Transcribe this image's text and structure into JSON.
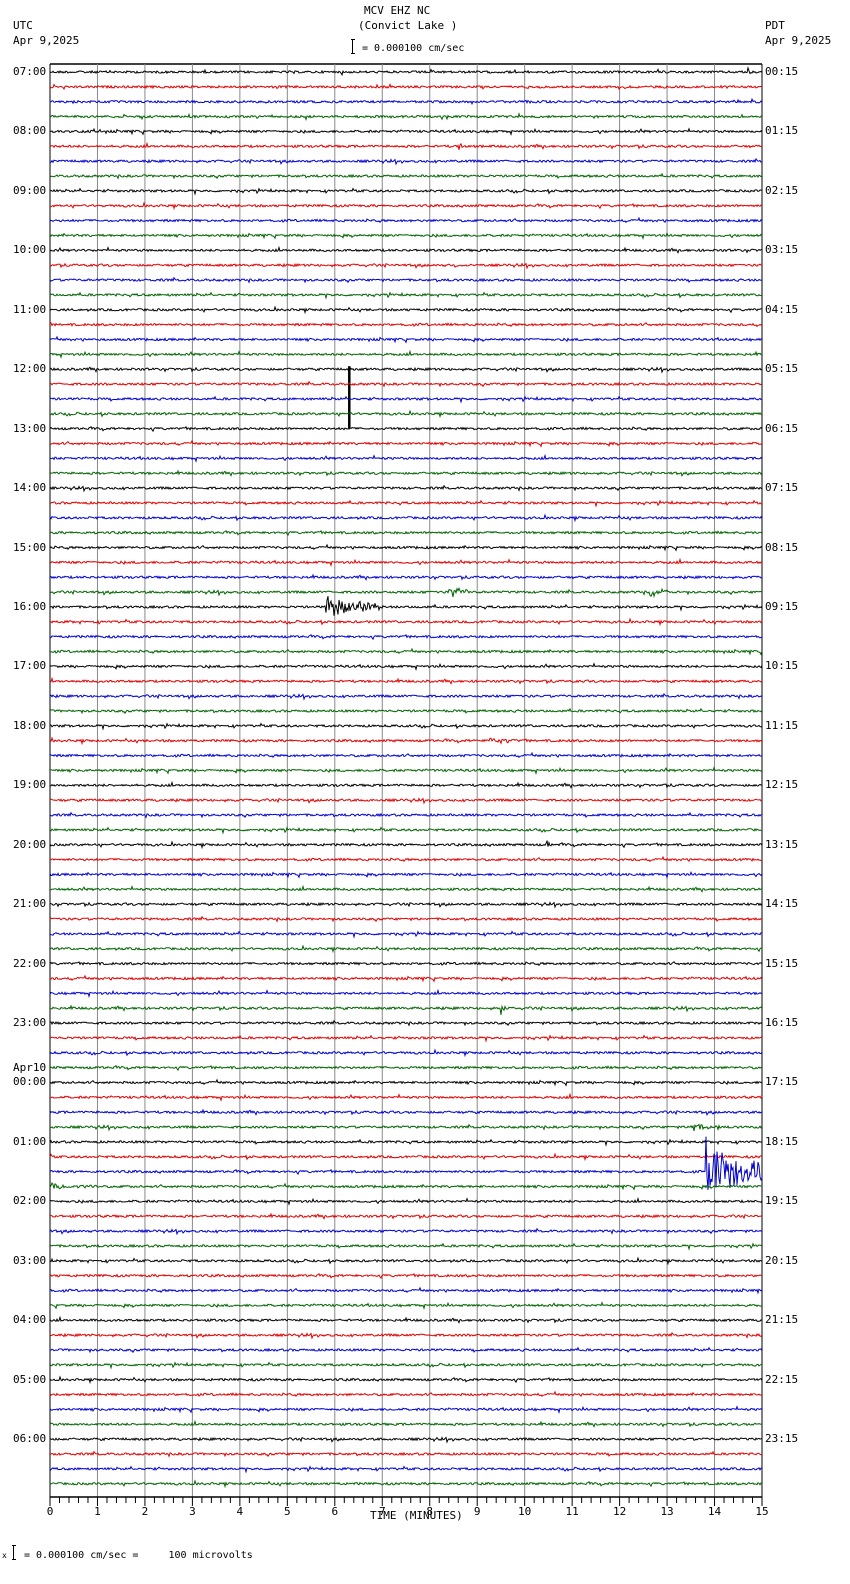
{
  "header": {
    "station": "MCV EHZ NC",
    "location": "(Convict Lake )",
    "scale_text": "= 0.000100 cm/sec",
    "left_tz": "UTC",
    "left_date": "Apr 9,2025",
    "right_tz": "PDT",
    "right_date": "Apr 9,2025"
  },
  "footer": {
    "scale_text": "= 0.000100 cm/sec =     100 microvolts",
    "mark": "x"
  },
  "chart_data": {
    "type": "line",
    "title": "MCV EHZ NC (Convict Lake )",
    "xlabel": "TIME (MINUTES)",
    "xlim": [
      0,
      15
    ],
    "x_ticks": [
      "0",
      "1",
      "2",
      "3",
      "4",
      "5",
      "6",
      "7",
      "8",
      "9",
      "10",
      "11",
      "12",
      "13",
      "14",
      "15"
    ],
    "traces_per_hour": 4,
    "trace_count": 96,
    "trace_colors": [
      "#000000",
      "#e00000",
      "#0000d0",
      "#006400"
    ],
    "left_labels": [
      {
        "trace": 0,
        "text": "07:00"
      },
      {
        "trace": 4,
        "text": "08:00"
      },
      {
        "trace": 8,
        "text": "09:00"
      },
      {
        "trace": 12,
        "text": "10:00"
      },
      {
        "trace": 16,
        "text": "11:00"
      },
      {
        "trace": 20,
        "text": "12:00"
      },
      {
        "trace": 24,
        "text": "13:00"
      },
      {
        "trace": 28,
        "text": "14:00"
      },
      {
        "trace": 32,
        "text": "15:00"
      },
      {
        "trace": 36,
        "text": "16:00"
      },
      {
        "trace": 40,
        "text": "17:00"
      },
      {
        "trace": 44,
        "text": "18:00"
      },
      {
        "trace": 48,
        "text": "19:00"
      },
      {
        "trace": 52,
        "text": "20:00"
      },
      {
        "trace": 56,
        "text": "21:00"
      },
      {
        "trace": 60,
        "text": "22:00"
      },
      {
        "trace": 64,
        "text": "23:00"
      },
      {
        "trace": 68,
        "text": "00:00",
        "date": "Apr10"
      },
      {
        "trace": 72,
        "text": "01:00"
      },
      {
        "trace": 76,
        "text": "02:00"
      },
      {
        "trace": 80,
        "text": "03:00"
      },
      {
        "trace": 84,
        "text": "04:00"
      },
      {
        "trace": 88,
        "text": "05:00"
      },
      {
        "trace": 92,
        "text": "06:00"
      }
    ],
    "right_labels": [
      "00:15",
      "01:15",
      "02:15",
      "03:15",
      "04:15",
      "05:15",
      "06:15",
      "07:15",
      "08:15",
      "09:15",
      "10:15",
      "11:15",
      "12:15",
      "13:15",
      "14:15",
      "15:15",
      "16:15",
      "17:15",
      "18:15",
      "19:15",
      "20:15",
      "21:15",
      "22:15",
      "23:15"
    ],
    "events": [
      {
        "trace": 0,
        "minute": 14.7,
        "duration": 0.1,
        "amplitude": 3
      },
      {
        "trace": 5,
        "minute": 8.6,
        "duration": 0.15,
        "amplitude": 4
      },
      {
        "trace": 13,
        "minute": 8.5,
        "duration": 0.15,
        "amplitude": 3
      },
      {
        "trace": 20,
        "minute": 6.3,
        "duration": 0.05,
        "amplitude": 60,
        "spike": true
      },
      {
        "trace": 35,
        "minute": 8.4,
        "duration": 0.4,
        "amplitude": 7
      },
      {
        "trace": 35,
        "minute": 12.6,
        "duration": 0.5,
        "amplitude": 4
      },
      {
        "trace": 36,
        "minute": 5.8,
        "duration": 1.2,
        "amplitude": 10
      },
      {
        "trace": 45,
        "minute": 9.2,
        "duration": 0.6,
        "amplitude": 3
      },
      {
        "trace": 52,
        "minute": 10.45,
        "duration": 0.2,
        "amplitude": 5
      },
      {
        "trace": 63,
        "minute": 9.5,
        "duration": 0.1,
        "amplitude": 5
      },
      {
        "trace": 71,
        "minute": 13.5,
        "duration": 0.6,
        "amplitude": 3
      },
      {
        "trace": 74,
        "minute": 13.8,
        "duration": 1.2,
        "amplitude": 28
      },
      {
        "trace": 75,
        "minute": 0.0,
        "duration": 1.0,
        "amplitude": 3
      }
    ]
  }
}
